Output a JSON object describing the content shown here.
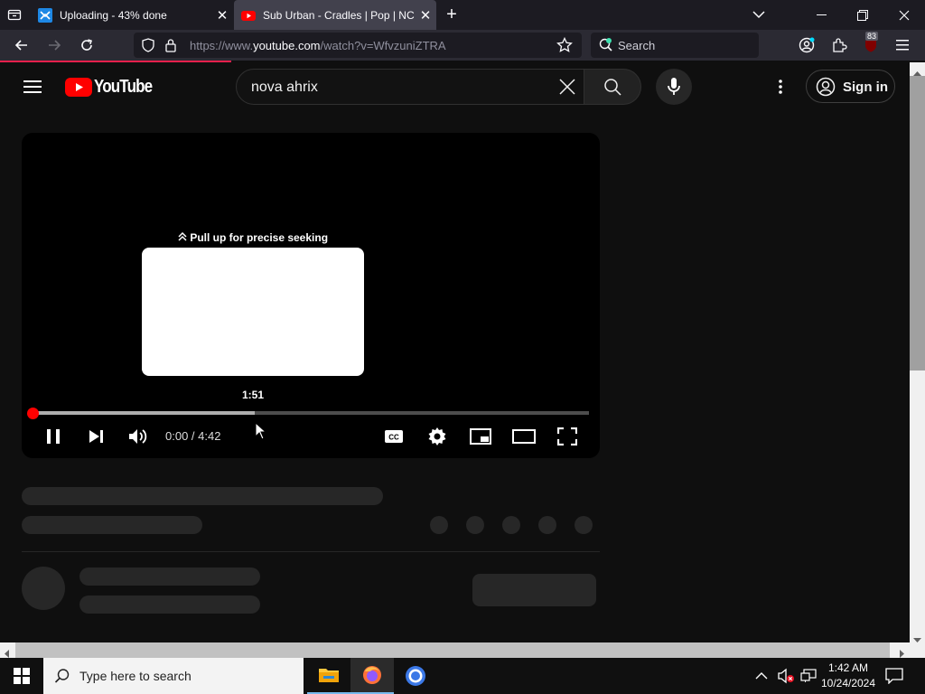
{
  "browser": {
    "tabs": [
      {
        "title": "Uploading - 43% done",
        "active": false
      },
      {
        "title": "Sub Urban - Cradles | Pop | NCS",
        "active": true
      }
    ],
    "url_prefix": "https://www.",
    "url_domain": "youtube.com",
    "url_rest": "/watch?v=WfvzuniZTRA",
    "search_placeholder": "Search",
    "extension_badge": "83",
    "page_load_progress": 0.25
  },
  "youtube": {
    "logo_text": "YouTube",
    "search_query": "nova ahrix",
    "sign_in_label": "Sign in",
    "player": {
      "seek_hint": "Pull up for precise seeking",
      "preview_time": "1:51",
      "time_display": "0:00 / 4:42",
      "hover_fraction": 0.4,
      "played_fraction": 0.0
    }
  },
  "taskbar": {
    "search_placeholder": "Type here to search",
    "time": "1:42 AM",
    "date": "10/24/2024"
  },
  "colors": {
    "accent_red": "#ff0000",
    "loading_line": "#e8204b"
  }
}
